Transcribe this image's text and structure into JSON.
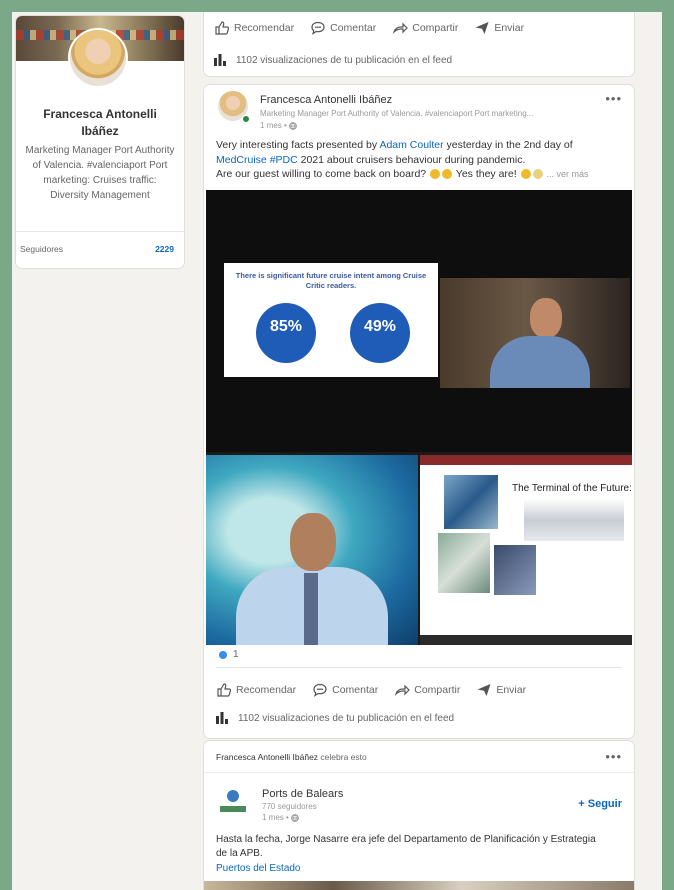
{
  "profile": {
    "name": "Francesca Antonelli Ibáñez",
    "headline": "Marketing Manager Port Authority of Valencia. #valenciaport Port marketing: Cruises traffic: Diversity Management",
    "followers_label": "Seguidores",
    "followers_count": "2229"
  },
  "actions": {
    "like": "Recomendar",
    "comment": "Comentar",
    "share": "Compartir",
    "send": "Enviar"
  },
  "post_top": {
    "views": "1102 visualizaciones de tu publicación en el feed"
  },
  "post_main": {
    "author": "Francesca Antonelli Ibáñez",
    "headline": "Marketing Manager Port Authority of Valencia. #valenciaport Port marketing...",
    "time": "1 mes •",
    "text_1a": "Very interesting facts presented by ",
    "mention": "Adam Coulter",
    "text_1b": " yesterday in the 2nd day of",
    "hashtag_1": "MedCruise",
    "hashtag_2": "#PDC",
    "text_2": " 2021 about cruisers behaviour during pandemic.",
    "text_3": "Are our guest willing to come back on board?",
    "text_4": " Yes they are!",
    "see_more": "... ver más",
    "slide_title": "There is significant future cruise intent among Cruise Critic readers.",
    "stat_1": "85%",
    "stat_2": "49%",
    "slide_right_title": "The Terminal of the Future:",
    "reactions": "1",
    "views": "1102 visualizaciones de tu publicación en el feed"
  },
  "post_bottom": {
    "celebrant": "Francesca Antonelli Ibáñez",
    "celebrates": " celebra esto",
    "org_name": "Ports de Balears",
    "org_followers": "770 seguidores",
    "time": "1 mes •",
    "follow_label": "+ Seguir",
    "text": "Hasta la fecha, Jorge Nasarre era jefe del Departamento de Planificación y Estrategia de la APB.",
    "tag": "Puertos del Estado"
  },
  "colors": {
    "background": "#7aa889",
    "accent": "#0a66c2",
    "online": "#2a8a3a"
  }
}
